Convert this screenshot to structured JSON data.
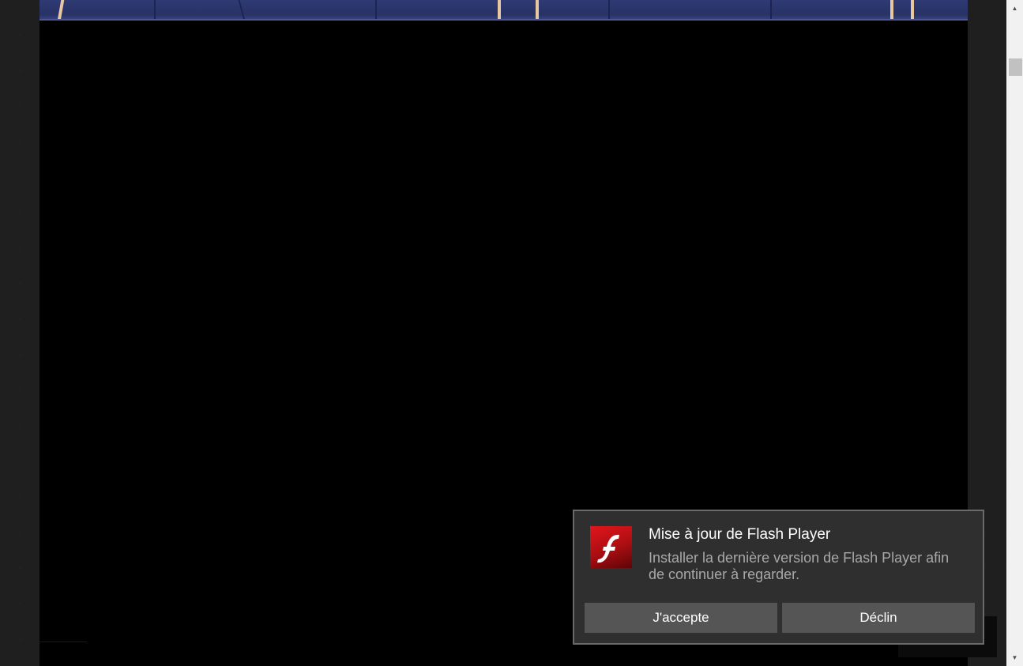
{
  "flash_dialog": {
    "title": "Mise à jour de Flash Player",
    "message": "Installer la dernière version de Flash Player afin de continuer à regarder.",
    "accept_label": "J'accepte",
    "decline_label": "Déclin",
    "icon": "flash-player-icon",
    "icon_letter": "f",
    "colors": {
      "dialog_background": "#2f2f2f",
      "dialog_border": "#6a6a6a",
      "button_background": "#555555",
      "icon_red": "#d8141a"
    }
  },
  "scrollbar": {
    "up_icon": "▲",
    "down_icon": "▼"
  },
  "colors": {
    "page_background": "#1f1f1f",
    "video_background": "#000000",
    "banner_blue": "#2f3a74"
  }
}
